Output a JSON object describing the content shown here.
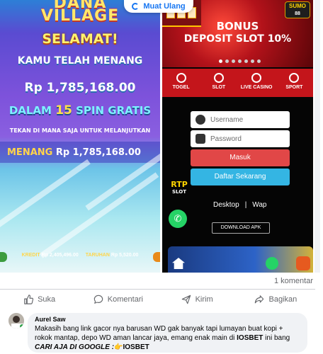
{
  "top_bar": {
    "reload_label": "Muat Ulang"
  },
  "game_panel": {
    "logo_line1": "DANA",
    "logo_line2": "VILLAGE",
    "selamat": "SELAMAT!",
    "kamu_menang": "KAMU TELAH MENANG",
    "amount": "Rp 1,785,168.00",
    "dalam": "DALAM",
    "spin_count": "15",
    "spin_gratis": "SPIN GRATIS",
    "tekan": "TEKAN DI MANA SAJA UNTUK MELANJUTKAN",
    "win_label": "MENANG",
    "win_value": "Rp 1,785,168.00",
    "kredit_label": "KREDIT",
    "kredit_value": "Rp 2,405,496.00",
    "taruhan_label": "TARUHAN",
    "taruhan_value": "Rp 5,520.00"
  },
  "casino_panel": {
    "logo_text": "SUMO",
    "logo_sub": "88",
    "bonus_line1": "BONUS",
    "bonus_line2": "DEPOSIT SLOT 10%",
    "nav": [
      "TOGEL",
      "SLOT",
      "LIVE CASINO",
      "SPORT"
    ],
    "username_placeholder": "Username",
    "password_placeholder": "Password",
    "login_label": "Masuk",
    "register_label": "Daftar Sekarang",
    "rtp": "RTP",
    "rtp_slot": "SLOT",
    "desktop_link": "Desktop",
    "link_sep": "|",
    "wap_link": "Wap",
    "apk_label": "DOWNLOAD APK"
  },
  "post": {
    "comment_count": "1 komentar",
    "actions": {
      "like": "Suka",
      "comment": "Komentari",
      "send": "Kirim",
      "share": "Bagikan"
    }
  },
  "comment": {
    "author": "Aurel Saw",
    "text_part1": "Makasih bang link gacor nya barusan WD gak banyak tapi lumayan buat kopi + rokok mantap, depo WD aman lancar jaya, emang enak main di ",
    "brand_bold": "IOSBET",
    "text_part2": " ini bang",
    "cta_italic": "CARI AJA DI GOOGLE :",
    "cta_emoji": "👉",
    "cta_brand": "IOSBET"
  },
  "colors": {
    "facebook_blue": "#1877f2",
    "secondary_text": "#65676b",
    "casino_red": "#c4151b",
    "login_red": "#e14747",
    "register_blue": "#34b5e3",
    "online_green": "#31a24c"
  }
}
